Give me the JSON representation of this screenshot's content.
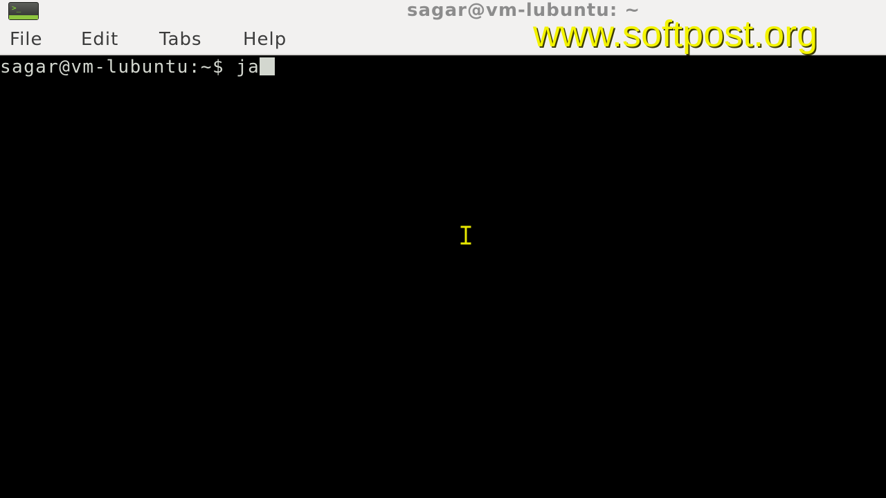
{
  "window": {
    "title": "sagar@vm-lubuntu: ~",
    "app_icon": "terminal-icon"
  },
  "menubar": {
    "items": [
      {
        "label": "File"
      },
      {
        "label": "Edit"
      },
      {
        "label": "Tabs"
      },
      {
        "label": "Help"
      }
    ]
  },
  "watermark": {
    "text": "www.softpost.org",
    "color": "#f3f300"
  },
  "terminal": {
    "prompt": "sagar@vm-lubuntu:~$ ",
    "input": "ja",
    "background": "#000000",
    "foreground": "#d3d7cf",
    "pointer_icon": "text-cursor-icon"
  }
}
